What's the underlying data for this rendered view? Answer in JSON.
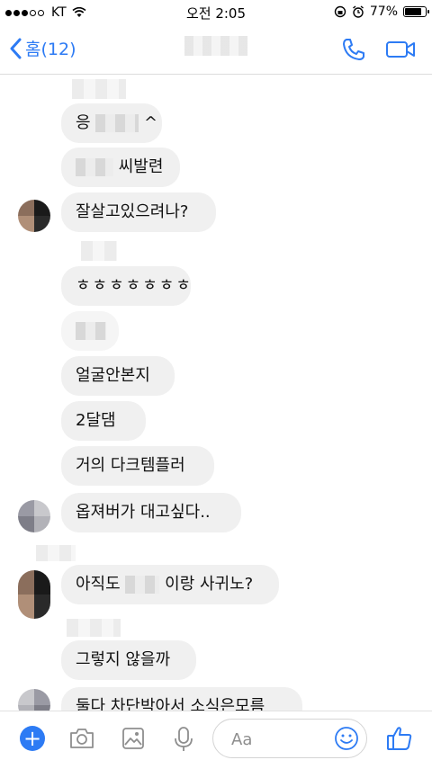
{
  "status_bar": {
    "carrier": "KT",
    "time": "오전 2:05",
    "battery": "77%"
  },
  "nav": {
    "back_label": "홈(12)",
    "contact_name": ""
  },
  "messages": [
    {
      "text_before": "응",
      "text_after": "^"
    },
    {
      "text_before": "",
      "text_after": "씨발련"
    },
    {
      "text_before": "잘살고있으려나?",
      "text_after": ""
    },
    {
      "text_before": "ㅎㅎㅎㅎㅎㅎㅎ",
      "text_after": ""
    },
    {
      "text_before": "",
      "text_after": ""
    },
    {
      "text_before": "얼굴안본지",
      "text_after": ""
    },
    {
      "text_before": "2달댐",
      "text_after": ""
    },
    {
      "text_before": "거의 다크템플러",
      "text_after": ""
    },
    {
      "text_before": "옵져버가 대고싶다..",
      "text_after": ""
    },
    {
      "text_before": "아직도",
      "text_after": "이랑 사귀노?"
    },
    {
      "text_before": "그렇지 않을까",
      "text_after": ""
    },
    {
      "text_before": "둘다 차단박아서 소식은모름",
      "text_after": ""
    }
  ],
  "composer": {
    "placeholder": "Aa"
  },
  "colors": {
    "accent": "#2d7bf4",
    "bubble": "#f0f0f0"
  },
  "icons": [
    "back-chevron-icon",
    "phone-icon",
    "video-icon",
    "plus-icon",
    "camera-icon",
    "gallery-icon",
    "microphone-icon",
    "emoji-icon",
    "thumbs-up-icon"
  ]
}
